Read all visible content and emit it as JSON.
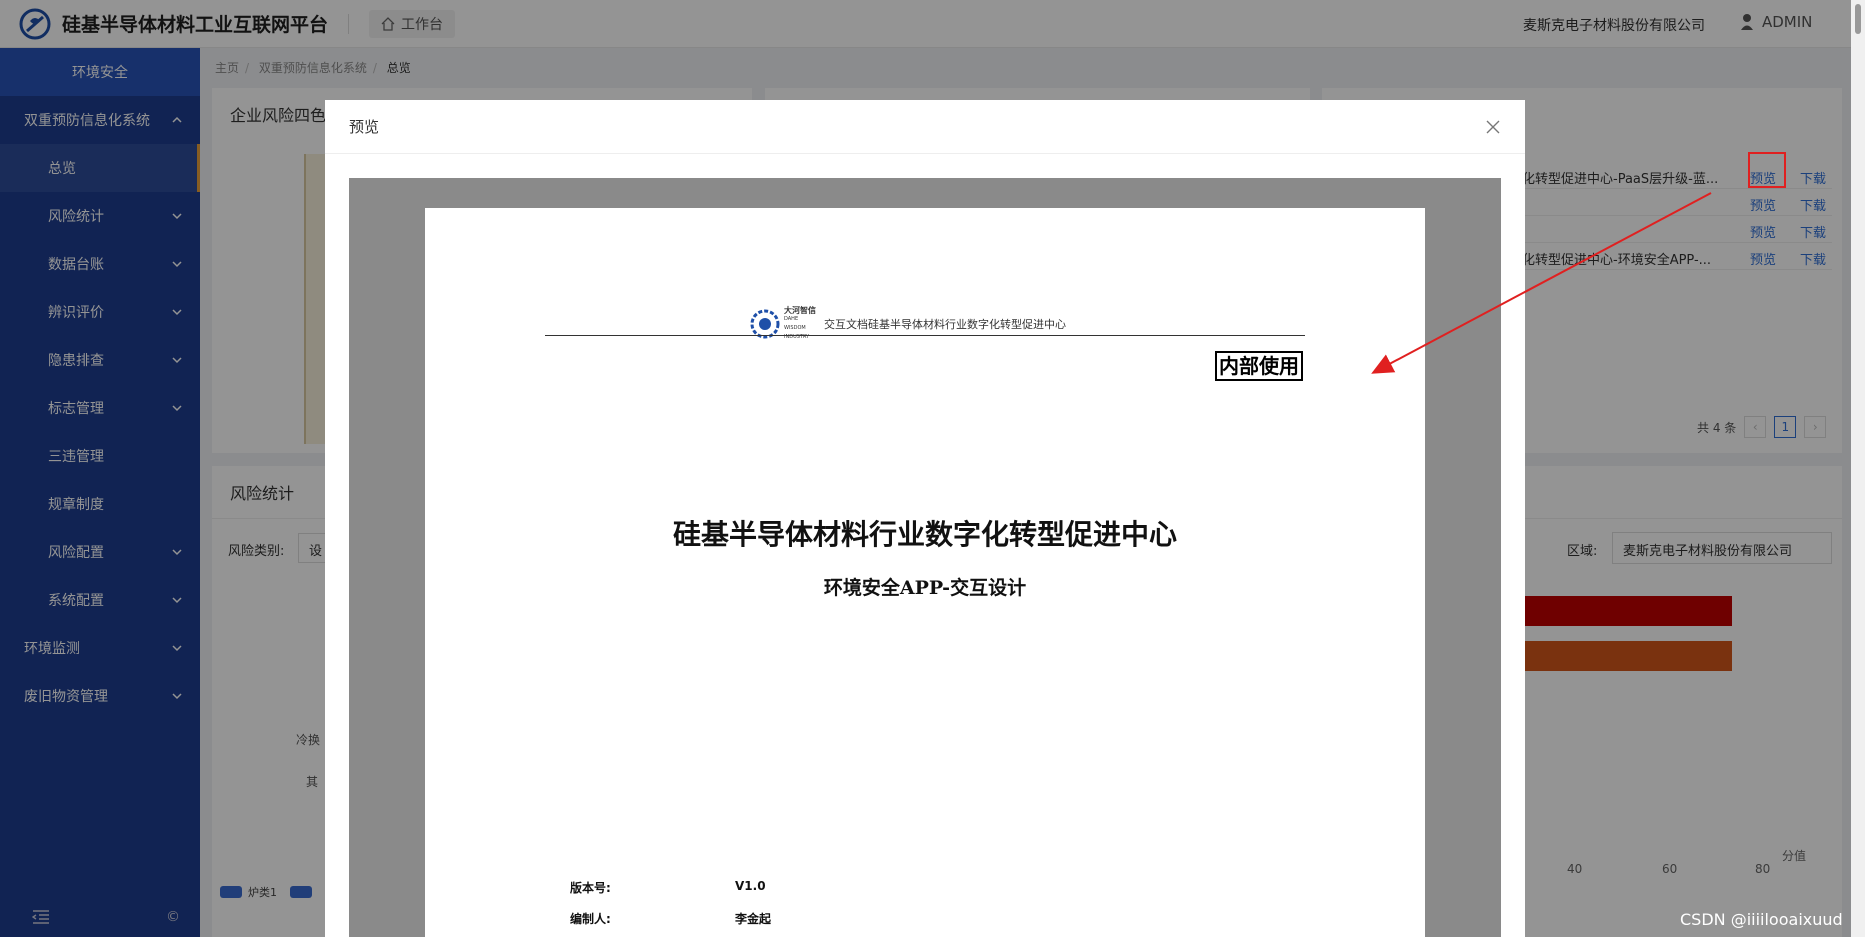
{
  "header": {
    "title": "硅基半导体材料工业互联网平台",
    "workbench": "工作台",
    "company": "麦斯克电子材料股份有限公司",
    "user": "ADMIN"
  },
  "sidebar": {
    "section": "环境安全",
    "items": [
      {
        "label": "双重预防信息化系统",
        "level": 1,
        "expanded": true
      },
      {
        "label": "总览",
        "level": 2,
        "active": true
      },
      {
        "label": "风险统计",
        "level": 2
      },
      {
        "label": "数据台账",
        "level": 2
      },
      {
        "label": "辨识评价",
        "level": 2
      },
      {
        "label": "隐患排查",
        "level": 2
      },
      {
        "label": "标志管理",
        "level": 2
      },
      {
        "label": "三违管理",
        "level": 2
      },
      {
        "label": "规章制度",
        "level": 2
      },
      {
        "label": "风险配置",
        "level": 2
      },
      {
        "label": "系统配置",
        "level": 2
      },
      {
        "label": "环境监测",
        "level": 1
      },
      {
        "label": "废旧物资管理",
        "level": 1
      }
    ],
    "footer_symbol": "©"
  },
  "breadcrumb": [
    "主页",
    "双重预防信息化系统",
    "总览"
  ],
  "background": {
    "panel1_title": "企业风险四色",
    "panel2_title": "风险统计",
    "risk_type_label": "风险类别:",
    "risk_type_value": "设",
    "region_label": "区域:",
    "region_value": "麦斯克电子材料股份有限公司",
    "doc_rows": [
      {
        "name": "化转型促进中心-PaaS层升级-蓝...",
        "preview": "预览",
        "download": "下载"
      },
      {
        "name": "",
        "preview": "预览",
        "download": "下载"
      },
      {
        "name": "",
        "preview": "预览",
        "download": "下载"
      },
      {
        "name": "化转型促进中心-环境安全APP-...",
        "preview": "预览",
        "download": "下载"
      }
    ],
    "pagination_total": "共 4 条",
    "pagination_page": "1",
    "axis_ticks": [
      "40",
      "60",
      "80"
    ],
    "axis_unit": "分值",
    "legend_item": "炉类1",
    "left_labels": [
      "冷换",
      "其"
    ]
  },
  "modal": {
    "title": "预览",
    "doc": {
      "logo_cn": "大河智信",
      "logo_en": "DAHE WISDOM INDUSTRY",
      "header_text": "交互文档硅基半导体材料行业数字化转型促进中心",
      "classification": "内部使用",
      "title": "硅基半导体材料行业数字化转型促进中心",
      "subtitle": "环境安全APP-交互设计",
      "version_label": "版本号:",
      "version_value": "V1.0",
      "author_label": "编制人:",
      "author_value": "李金起"
    }
  },
  "watermark": "CSDN @iiiilooaixuud",
  "colors": {
    "sidebar": "#1e3d8f",
    "link": "#2f6fd6",
    "highlight": "#e02020",
    "bar_red": "#c00000",
    "bar_orange": "#d2561b"
  }
}
